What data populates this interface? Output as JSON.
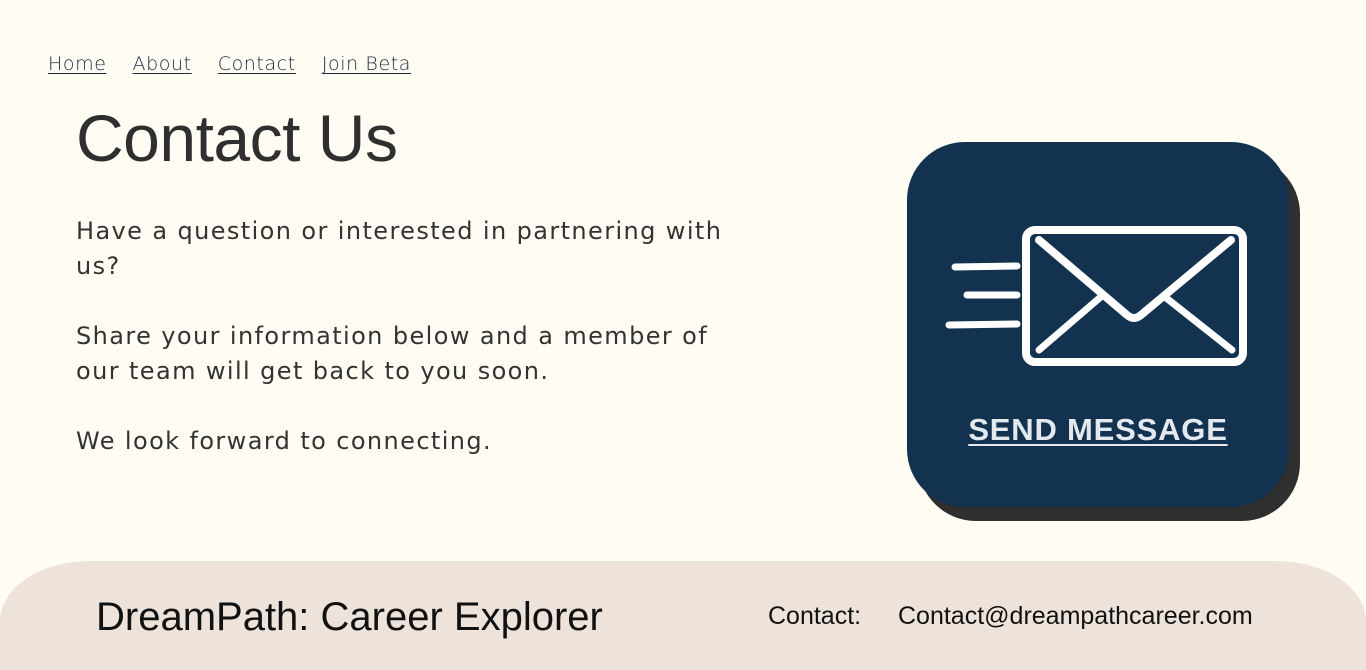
{
  "nav": {
    "items": [
      {
        "label": "Home"
      },
      {
        "label": "About"
      },
      {
        "label": "Contact"
      },
      {
        "label": "Join Beta"
      }
    ]
  },
  "main": {
    "title": "Contact Us",
    "paragraphs": [
      "Have a question or interested in partnering with us?",
      "Share your information below and a member of our team will get back to you soon.",
      "We look forward to connecting."
    ]
  },
  "cta": {
    "icon": "envelope-icon",
    "label": "SEND MESSAGE",
    "background_color": "#12324f",
    "shadow_color": "#2f2f2f"
  },
  "footer": {
    "brand": "DreamPath: Career Explorer",
    "contact_label": "Contact:",
    "email": "Contact@dreampathcareer.com",
    "background_color": "#ede3da"
  }
}
